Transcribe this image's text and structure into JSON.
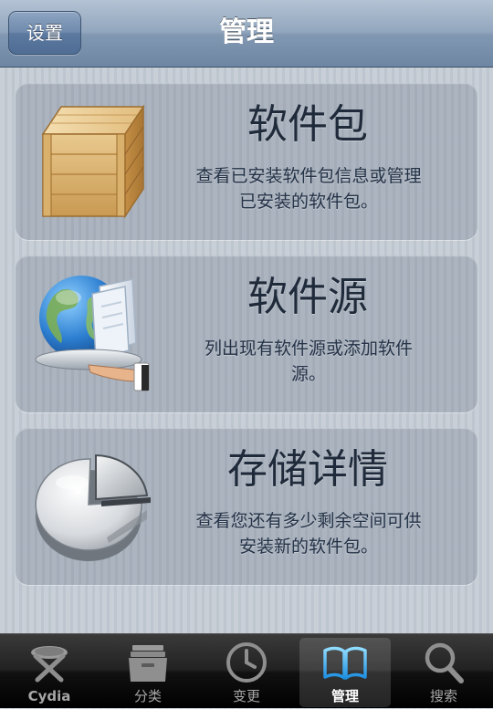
{
  "navbar": {
    "back_label": "设置",
    "title": "管理"
  },
  "cards": [
    {
      "title": "软件包",
      "desc_lines": [
        "查看已安装软件包信息或管理",
        "已安装的软件包。"
      ],
      "icon": "package-box-icon"
    },
    {
      "title": "软件源",
      "desc_lines": [
        "列出现有软件源或添加软件",
        "源。"
      ],
      "icon": "globe-sources-icon"
    },
    {
      "title": "存储详情",
      "desc_lines": [
        "查看您还有多少剩余空间可供",
        "安装新的软件包。"
      ],
      "icon": "storage-pie-icon"
    }
  ],
  "tabbar": {
    "items": [
      {
        "label": "Cydia",
        "icon": "cydia-icon",
        "selected": false
      },
      {
        "label": "分类",
        "icon": "sections-icon",
        "selected": false
      },
      {
        "label": "变更",
        "icon": "clock-icon",
        "selected": false
      },
      {
        "label": "管理",
        "icon": "book-icon",
        "selected": true
      },
      {
        "label": "搜索",
        "icon": "search-icon",
        "selected": false
      }
    ]
  },
  "colors": {
    "nav_blue": "#7f94ae",
    "selected_tab_icon": "#4fb6f2",
    "title_text": "#1f2a3a"
  }
}
